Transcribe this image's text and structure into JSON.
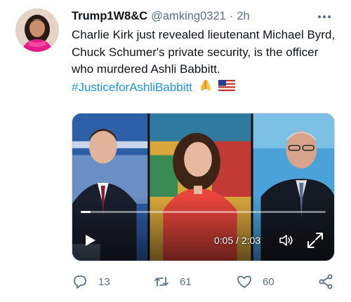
{
  "tweet": {
    "display_name": "Trump1W8&C",
    "handle": "@amking0321",
    "separator": "·",
    "time": "2h",
    "text_main": "Charlie Kirk just revealed lieutenant Michael Byrd, Chuck Schumer's private security, is the officer who murdered Ashli Babbitt.",
    "hashtag": "#JusticeforAshliBabbitt",
    "emojis": [
      "folded-hands-emoji",
      "us-flag-emoji"
    ]
  },
  "video": {
    "time_readout": "0:05 / 2:03",
    "progress": 0.04,
    "controls": [
      "play-icon",
      "volume-icon",
      "fullscreen-icon"
    ]
  },
  "actions": {
    "reply_count": "13",
    "retweet_count": "61",
    "like_count": "60"
  },
  "colors": {
    "text": "#0f1419",
    "secondary": "#5b7083",
    "link": "#1b95e0"
  }
}
